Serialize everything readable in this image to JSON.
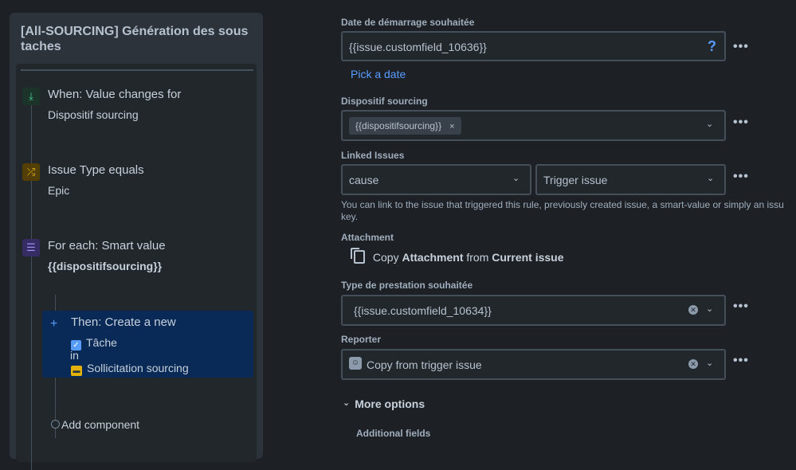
{
  "rule": {
    "title": "[All-SOURCING] Génération des sous taches",
    "components": [
      {
        "title": "When: Value changes for",
        "subtitle": "Dispositif sourcing",
        "icon": "trigger-icon"
      },
      {
        "title": "Issue Type equals",
        "subtitle": "Epic",
        "icon": "shuffle-icon"
      },
      {
        "title": "For each: Smart value",
        "subtitle": "{{dispositifsourcing}}",
        "icon": "list-icon"
      }
    ],
    "action": {
      "title": "Then: Create a new",
      "issue_type": "Tâche",
      "in_label": "in",
      "project": "Sollicitation sourcing"
    },
    "add_component": "Add component"
  },
  "form": {
    "start_date": {
      "label": "Date de démarrage souhaitée",
      "value": "{{issue.customfield_10636}}",
      "help": "?",
      "pick_link": "Pick a date"
    },
    "dispositif": {
      "label": "Dispositif sourcing",
      "tag": "{{dispositifsourcing}}",
      "tag_remove": "×"
    },
    "linked": {
      "label": "Linked Issues",
      "relation": "cause",
      "target": "Trigger issue",
      "helper": "You can link to the issue that triggered this rule, previously created issue, a smart-value or simply an issu",
      "helper_line2": "key."
    },
    "attachment": {
      "label": "Attachment",
      "copy": "Copy",
      "attachment_word": "Attachment",
      "from": "from",
      "source": "Current issue"
    },
    "prestation": {
      "label": "Type de prestation souhaitée",
      "value": "{{issue.customfield_10634}}"
    },
    "reporter": {
      "label": "Reporter",
      "value": "Copy from trigger issue"
    },
    "more_options": "More options",
    "additional_fields": "Additional fields"
  },
  "glyphs": {
    "more": "•••",
    "chevron_down": "⌄",
    "clear": "✕",
    "collapse": "⌄"
  }
}
